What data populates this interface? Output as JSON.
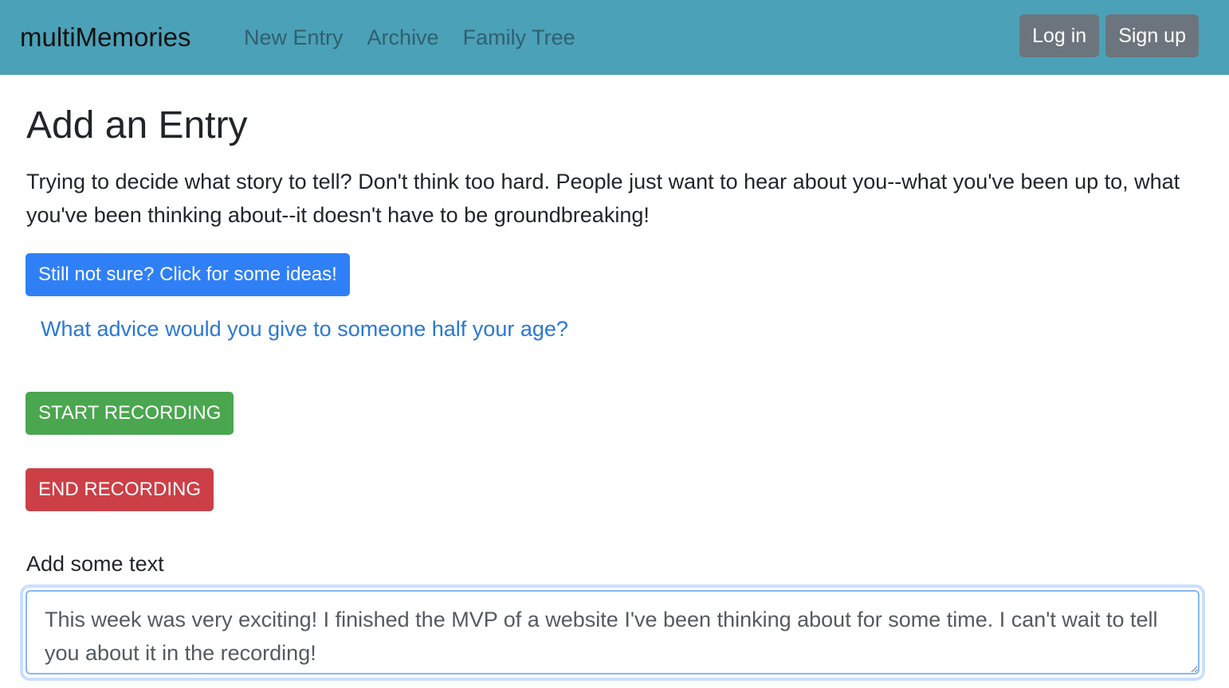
{
  "navbar": {
    "brand": "multiMemories",
    "links": [
      "New Entry",
      "Archive",
      "Family Tree"
    ],
    "login_label": "Log in",
    "signup_label": "Sign up"
  },
  "main": {
    "title": "Add an Entry",
    "intro": "Trying to decide what story to tell? Don't think too hard. People just want to hear about you--what you've been up to, what you've been thinking about--it doesn't have to be groundbreaking!",
    "ideas_button": "Still not sure? Click for some ideas!",
    "idea_prompt": "What advice would you give to someone half your age?",
    "start_recording": "START RECORDING",
    "end_recording": "END RECORDING",
    "text_label": "Add some text",
    "text_value": "This week was very exciting! I finished the MVP of a website I've been thinking about for some time. I can't wait to tell you about it in the recording!"
  },
  "colors": {
    "navbar_bg": "#4ba1b7",
    "primary": "#2f80f6",
    "success": "#4aa64f",
    "danger": "#cc3f46",
    "secondary": "#6c757d"
  }
}
